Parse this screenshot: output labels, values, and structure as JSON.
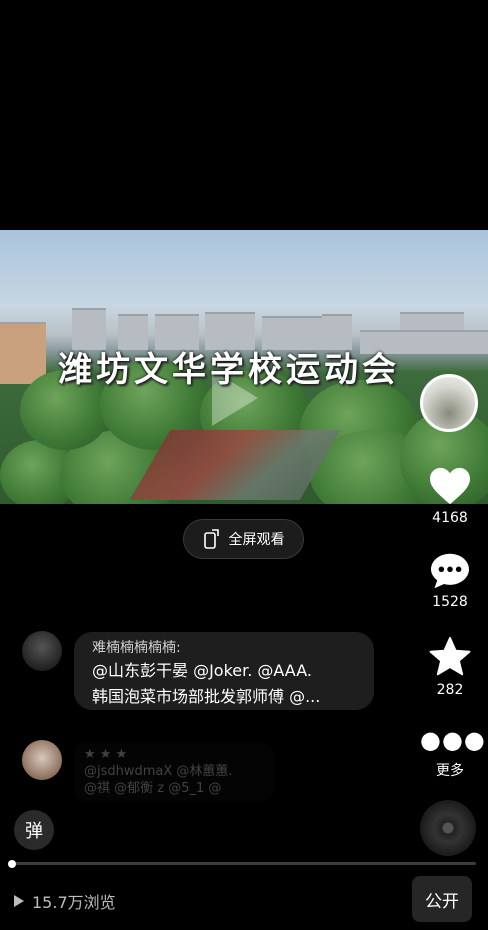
{
  "video": {
    "title": "潍坊文华学校运动会"
  },
  "rail": {
    "like_count": "4168",
    "comment_count": "1528",
    "favorite_count": "282",
    "more_label": "更多"
  },
  "fullscreen": {
    "label": "全屏观看"
  },
  "comments": [
    {
      "author": "难楠楠楠楠楠:",
      "line1": "@山东彭干晏 @Joker. @AAA.",
      "line2": "韩国泡菜市场部批发郭师傅 @..."
    },
    {
      "author": "",
      "line1": "@jsdhwdmaX @林蕙蕙.",
      "line2": "@祺  @郁衡 z @5_1 @"
    }
  ],
  "danmu": {
    "label": "弹"
  },
  "playback": {
    "progress": 0.005
  },
  "footer": {
    "views": "15.7万浏览",
    "public_label": "公开"
  },
  "colors": {
    "background": "#000000",
    "bubble": "#1e1e1e"
  }
}
